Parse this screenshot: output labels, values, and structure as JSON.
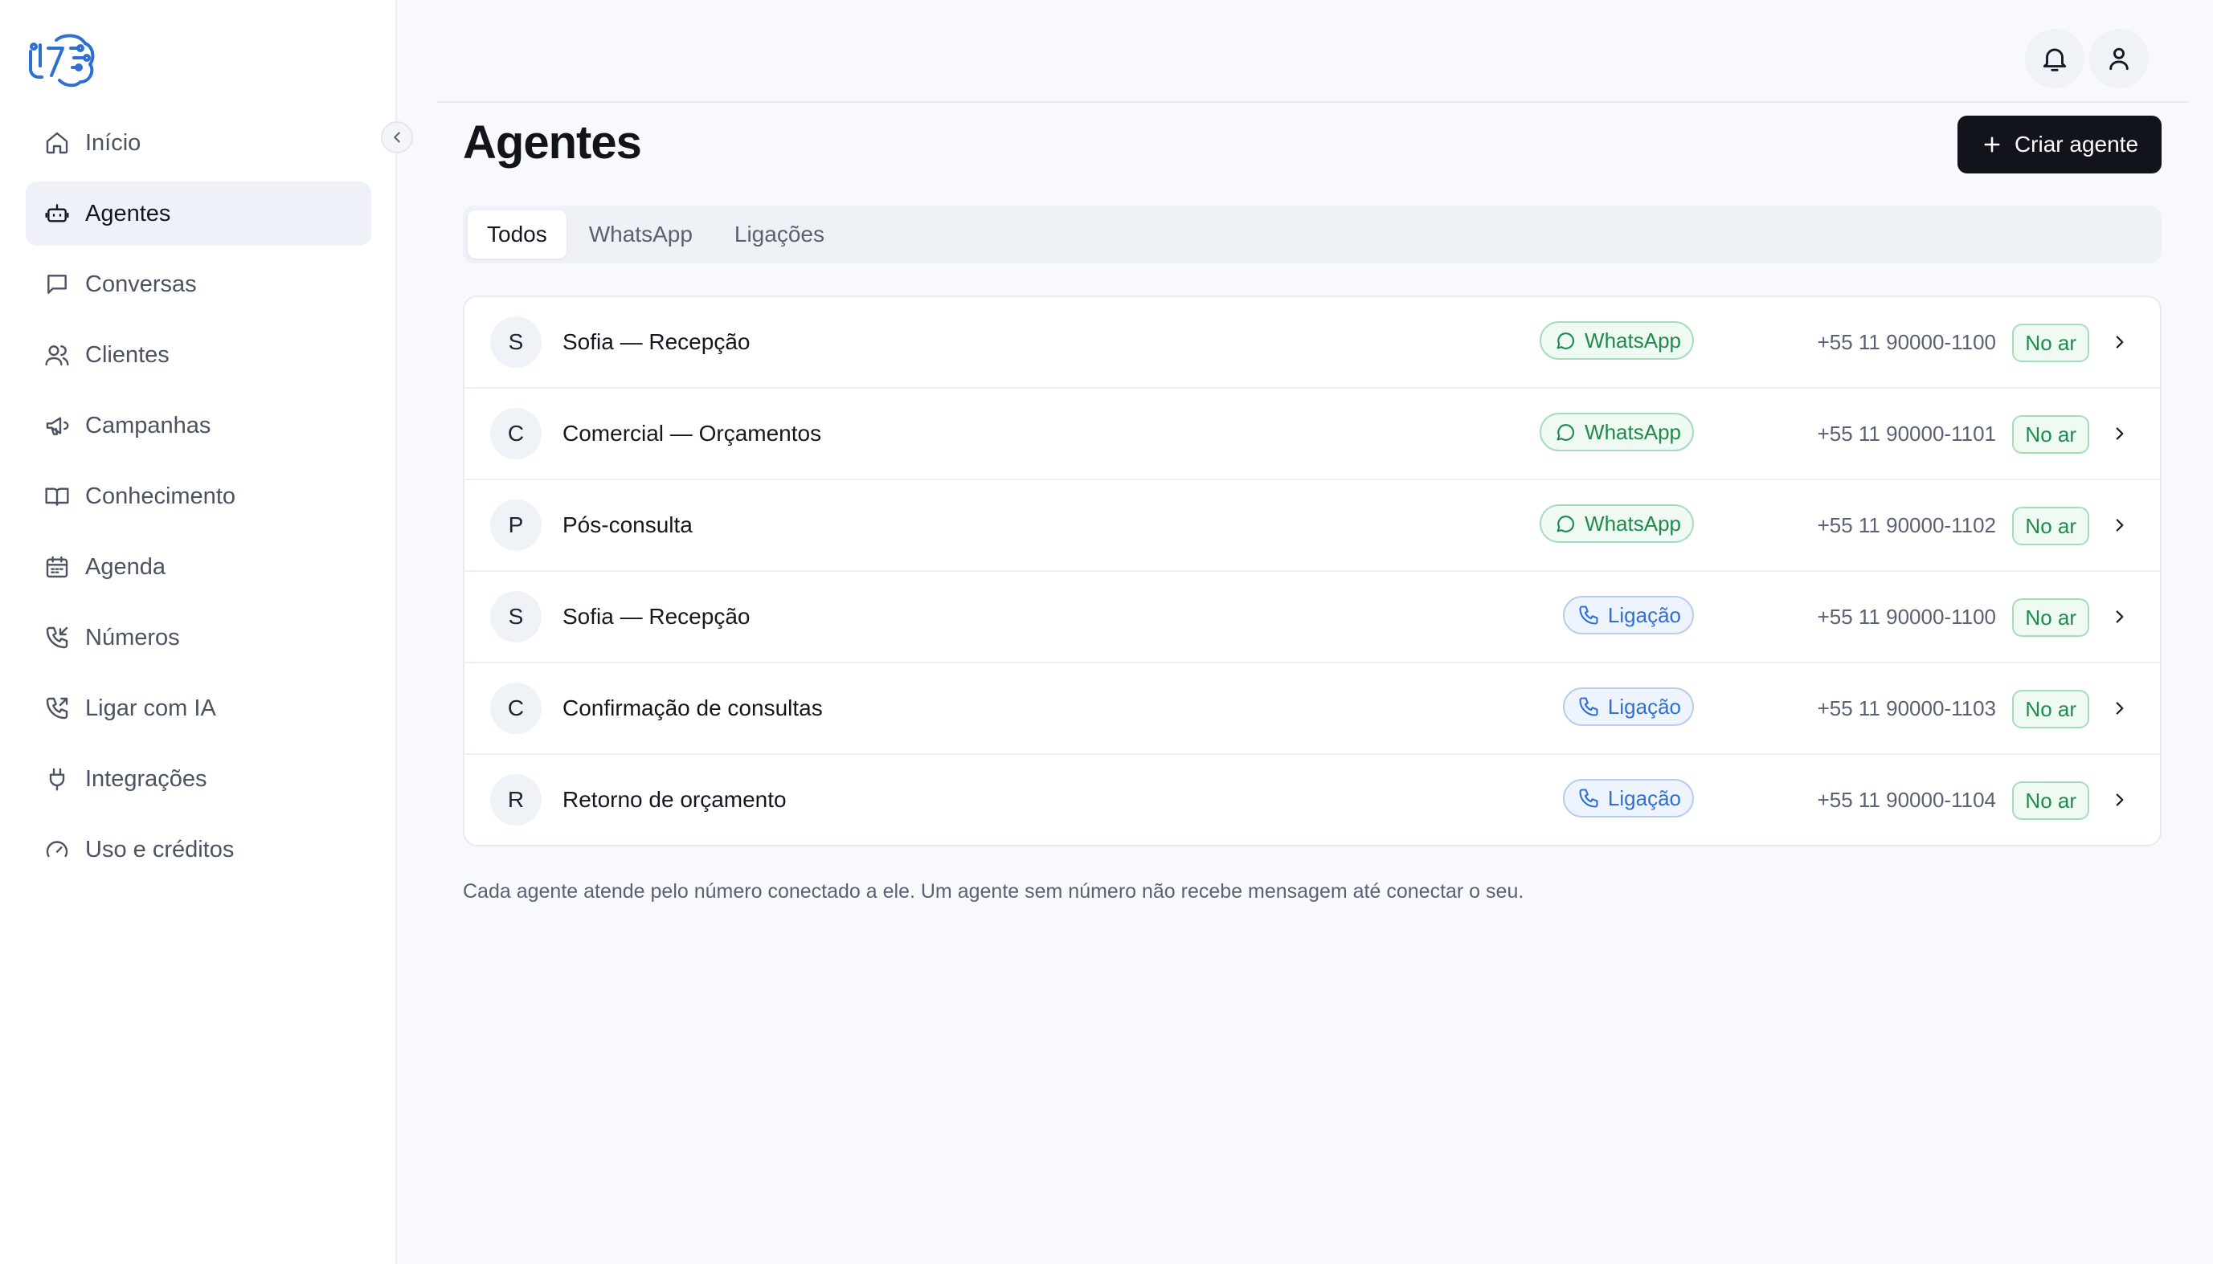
{
  "colors": {
    "brand": "#2f6fd1",
    "dark": "#11141b",
    "whatsapp": "#1f8a4c",
    "call": "#2f6fd1"
  },
  "sidebar": {
    "logo_icon": "brain-logo-icon",
    "collapse_icon": "chevron-left-icon",
    "items": [
      {
        "label": "Início",
        "icon": "home-icon"
      },
      {
        "label": "Agentes",
        "icon": "bot-icon"
      },
      {
        "label": "Conversas",
        "icon": "chat-icon"
      },
      {
        "label": "Clientes",
        "icon": "users-icon"
      },
      {
        "label": "Campanhas",
        "icon": "megaphone-icon"
      },
      {
        "label": "Conhecimento",
        "icon": "book-icon"
      },
      {
        "label": "Agenda",
        "icon": "calendar-icon"
      },
      {
        "label": "Números",
        "icon": "phone-incoming-icon"
      },
      {
        "label": "Ligar com IA",
        "icon": "phone-outgoing-icon"
      },
      {
        "label": "Integrações",
        "icon": "plug-icon"
      },
      {
        "label": "Uso e créditos",
        "icon": "gauge-icon"
      }
    ],
    "active_index": 1
  },
  "header": {
    "notification_icon": "bell-icon",
    "profile_icon": "user-icon"
  },
  "main": {
    "title": "Agentes",
    "create_button": "Criar agente",
    "tabs": [
      {
        "label": "Todos"
      },
      {
        "label": "WhatsApp"
      },
      {
        "label": "Ligações"
      }
    ],
    "active_tab": 0,
    "agents": [
      {
        "initial": "S",
        "name": "Sofia — Recepção",
        "channel": "WhatsApp",
        "channel_type": "whatsapp",
        "phone": "+55 11 90000-1100",
        "status": "No ar"
      },
      {
        "initial": "C",
        "name": "Comercial — Orçamentos",
        "channel": "WhatsApp",
        "channel_type": "whatsapp",
        "phone": "+55 11 90000-1101",
        "status": "No ar"
      },
      {
        "initial": "P",
        "name": "Pós-consulta",
        "channel": "WhatsApp",
        "channel_type": "whatsapp",
        "phone": "+55 11 90000-1102",
        "status": "No ar"
      },
      {
        "initial": "S",
        "name": "Sofia — Recepção",
        "channel": "Ligação",
        "channel_type": "call",
        "phone": "+55 11 90000-1100",
        "status": "No ar"
      },
      {
        "initial": "C",
        "name": "Confirmação de consultas",
        "channel": "Ligação",
        "channel_type": "call",
        "phone": "+55 11 90000-1103",
        "status": "No ar"
      },
      {
        "initial": "R",
        "name": "Retorno de orçamento",
        "channel": "Ligação",
        "channel_type": "call",
        "phone": "+55 11 90000-1104",
        "status": "No ar"
      }
    ],
    "footnote": "Cada agente atende pelo número conectado a ele. Um agente sem número não recebe mensagem até conectar o seu."
  }
}
